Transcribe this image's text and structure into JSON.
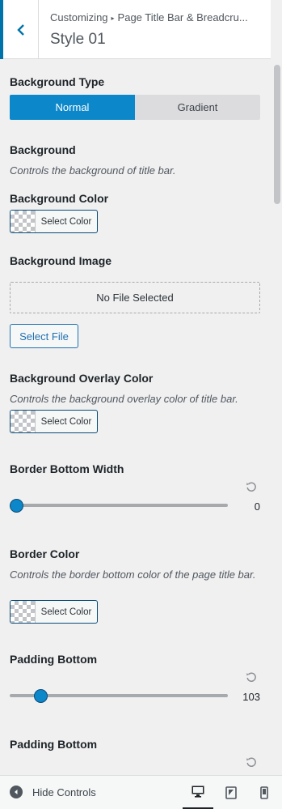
{
  "header": {
    "breadcrumb_root": "Customizing",
    "breadcrumb_sep": "▸",
    "breadcrumb_section": "Page Title Bar & Breadcru...",
    "title": "Style 01"
  },
  "fields": {
    "background_type": {
      "label": "Background Type",
      "options": [
        "Normal",
        "Gradient"
      ],
      "selected": "Normal"
    },
    "background": {
      "label": "Background",
      "desc": "Controls the background of title bar."
    },
    "background_color": {
      "label": "Background Color",
      "button": "Select Color"
    },
    "background_image": {
      "label": "Background Image",
      "placeholder": "No File Selected",
      "button": "Select File"
    },
    "overlay_color": {
      "label": "Background Overlay Color",
      "desc": "Controls the background overlay color of title bar.",
      "button": "Select Color"
    },
    "border_width": {
      "label": "Border Bottom Width",
      "value": "0",
      "fraction": 0.0
    },
    "border_color": {
      "label": "Border Color",
      "desc": "Controls the border bottom color of the page title bar.",
      "button": "Select Color"
    },
    "padding_bottom": {
      "label": "Padding Bottom",
      "value": "103",
      "fraction": 0.12
    },
    "padding_bottom_2": {
      "label": "Padding Bottom"
    }
  },
  "footer": {
    "hide_controls": "Hide Controls",
    "devices": [
      "desktop",
      "tablet",
      "mobile"
    ],
    "active_device": "desktop"
  },
  "colors": {
    "accent": "#0c87c9",
    "link": "#2271b1"
  }
}
